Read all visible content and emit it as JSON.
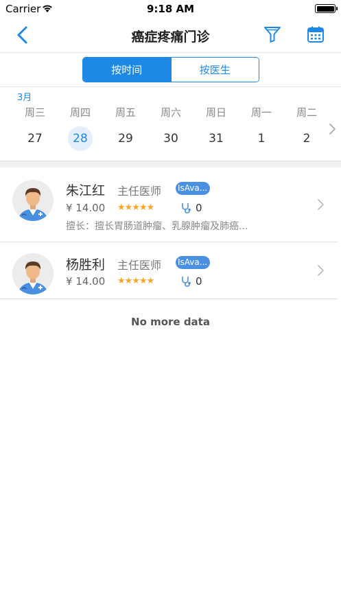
{
  "status": {
    "carrier": "Carrier",
    "time": "9:18 AM"
  },
  "nav": {
    "title": "癌症疼痛门诊",
    "back_icon": "chevron-left-icon",
    "filter_icon": "filter-icon",
    "calendar_icon": "calendar-icon"
  },
  "segment": {
    "by_time": "按时间",
    "by_doctor": "按医生",
    "selected": "by_time"
  },
  "calendar": {
    "month": "3月",
    "days": [
      {
        "weekday": "周三",
        "date": "27"
      },
      {
        "weekday": "周四",
        "date": "28"
      },
      {
        "weekday": "周五",
        "date": "29"
      },
      {
        "weekday": "周六",
        "date": "30"
      },
      {
        "weekday": "周日",
        "date": "31"
      },
      {
        "weekday": "周一",
        "date": "1"
      },
      {
        "weekday": "周二",
        "date": "2"
      }
    ],
    "selected_date": "28"
  },
  "doctors": [
    {
      "name": "朱江红",
      "title": "主任医师",
      "badge": "IsAva...",
      "price": "¥ 14.00",
      "stars": "★★★★★",
      "consult_count": "0",
      "specialty": "擅长：擅长胃肠道肿瘤、乳腺肿瘤及肺癌..."
    },
    {
      "name": "杨胜利",
      "title": "主任医师",
      "badge": "IsAva...",
      "price": "¥ 14.00",
      "stars": "★★★★★",
      "consult_count": "0",
      "specialty": ""
    }
  ],
  "footer": {
    "no_more": "No more data"
  },
  "colors": {
    "accent": "#1e88e5",
    "badge": "#4a90e2",
    "star": "#f5a623"
  }
}
